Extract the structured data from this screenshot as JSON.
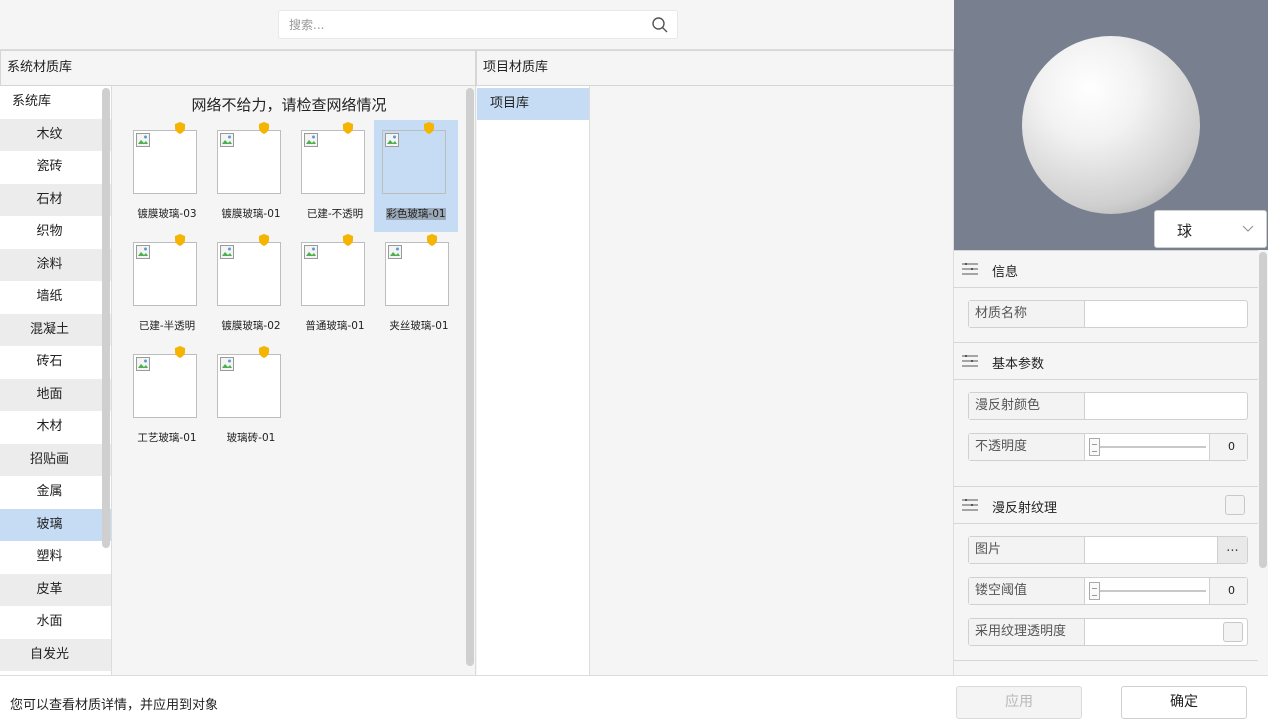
{
  "search": {
    "placeholder": "搜索..."
  },
  "system_library": {
    "header": "系统材质库",
    "categories": [
      {
        "label": "系统库"
      },
      {
        "label": "木纹"
      },
      {
        "label": "瓷砖"
      },
      {
        "label": "石材"
      },
      {
        "label": "织物"
      },
      {
        "label": "涂料"
      },
      {
        "label": "墙纸"
      },
      {
        "label": "混凝土"
      },
      {
        "label": "砖石"
      },
      {
        "label": "地面"
      },
      {
        "label": "木材"
      },
      {
        "label": "招贴画"
      },
      {
        "label": "金属"
      },
      {
        "label": "玻璃"
      },
      {
        "label": "塑料"
      },
      {
        "label": "皮革"
      },
      {
        "label": "水面"
      },
      {
        "label": "自发光"
      }
    ],
    "selected_category": "玻璃",
    "network_message": "网络不给力，请检查网络情况",
    "materials": [
      {
        "label": "镀膜玻璃-03"
      },
      {
        "label": "镀膜玻璃-01"
      },
      {
        "label": "已建-不透明"
      },
      {
        "label": "彩色玻璃-01"
      },
      {
        "label": "已建-半透明"
      },
      {
        "label": "镀膜玻璃-02"
      },
      {
        "label": "普通玻璃-01"
      },
      {
        "label": "夹丝玻璃-01"
      },
      {
        "label": "工艺玻璃-01"
      },
      {
        "label": "玻璃砖-01"
      }
    ],
    "selected_material": "彩色玻璃-01"
  },
  "project_library": {
    "header": "项目材质库",
    "items": [
      {
        "label": "项目库"
      }
    ]
  },
  "preview": {
    "shape_value": "球"
  },
  "properties": {
    "info": {
      "title": "信息",
      "name_label": "材质名称",
      "name_value": ""
    },
    "basic": {
      "title": "基本参数",
      "diffuse_color_label": "漫反射颜色",
      "opacity_label": "不透明度",
      "opacity_value": "0"
    },
    "diffuse_texture": {
      "title": "漫反射纹理",
      "image_label": "图片",
      "image_button": "...",
      "cutout_label": "镂空阈值",
      "cutout_value": "0",
      "use_alpha_label": "采用纹理透明度"
    }
  },
  "footer": {
    "hint": "您可以查看材质详情，并应用到对象",
    "apply_label": "应用",
    "ok_label": "确定"
  },
  "colors": {
    "selection": "#c6dcf5",
    "preview_bg": "#78808f",
    "shield": "#f5b400"
  }
}
